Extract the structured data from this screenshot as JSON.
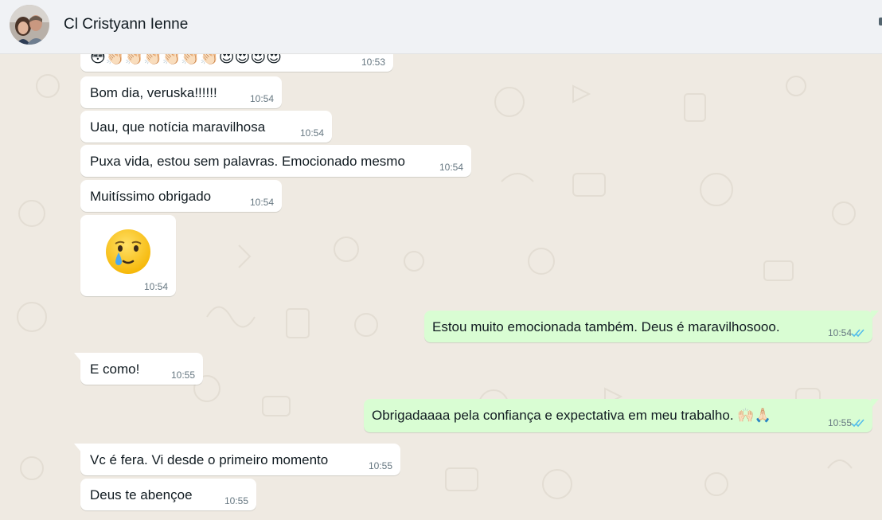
{
  "contact": {
    "name": "Cl Cristyann Ienne"
  },
  "messages": [
    {
      "dir": "in",
      "text": "😳👏🏻👏🏻👏🏻👏🏻👏🏻👏🏻😍😍😍😍",
      "time": "10:53"
    },
    {
      "dir": "in",
      "text": "Bom dia, veruska!!!!!!",
      "time": "10:54"
    },
    {
      "dir": "in",
      "text": "Uau, que notícia maravilhosa",
      "time": "10:54"
    },
    {
      "dir": "in",
      "text": "Puxa vida, estou sem palavras. Emocionado mesmo",
      "time": "10:54"
    },
    {
      "dir": "in",
      "text": "Muitíssimo obrigado",
      "time": "10:54"
    },
    {
      "dir": "in",
      "emoji": "face-holding-back-tears",
      "time": "10:54"
    },
    {
      "dir": "out",
      "text": "Estou muito emocionada também. Deus é maravilhosooo.",
      "time": "10:54",
      "status": "read"
    },
    {
      "dir": "in",
      "text": "E como!",
      "time": "10:55"
    },
    {
      "dir": "out",
      "text": "Obrigadaaaa pela confiança e expectativa em meu trabalho. 🙌🏻🙏🏻",
      "time": "10:55",
      "status": "read"
    },
    {
      "dir": "in",
      "text": "Vc é fera. Vi desde o primeiro momento",
      "time": "10:55"
    },
    {
      "dir": "in",
      "text": "Deus te abençoe",
      "time": "10:55"
    }
  ],
  "colors": {
    "header_bg": "#f0f2f5",
    "chat_bg": "#efeae2",
    "incoming_bubble": "#ffffff",
    "outgoing_bubble": "#d9fdd3",
    "read_ticks": "#53bdeb"
  }
}
